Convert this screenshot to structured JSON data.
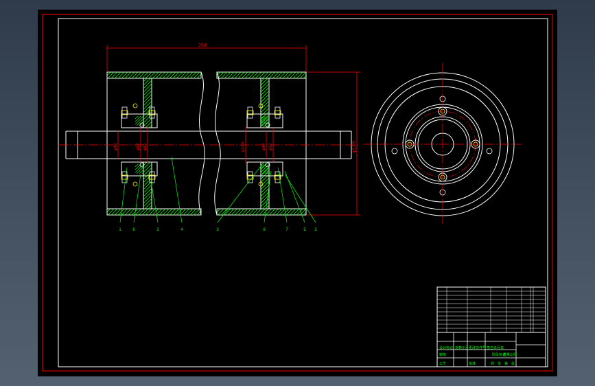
{
  "drawing": {
    "colors": {
      "background": "#000000",
      "frame": "#ff0000",
      "outline": "#ffffff",
      "centerline": "#ff0000",
      "leader": "#00ff00",
      "fastener": "#ffff00",
      "hatch": "#00ff00"
    },
    "dimensions": {
      "overall_length": "350",
      "outer_diameter": "φ120",
      "hub_diameter": "φ130",
      "left_shaft": "φ40",
      "left_bore": "φ52",
      "left_inner": "φ62",
      "right_shaft": "φ40",
      "right_bore": "φ52"
    },
    "part_numbers": [
      "1",
      "6",
      "2",
      "4",
      "3",
      "8",
      "7",
      "5",
      "2"
    ],
    "title_block": {
      "row1": [
        "设计",
        "标记",
        "处数",
        "分区",
        "更改文件号",
        "签名",
        "年月日"
      ],
      "row2": [
        "审核",
        "",
        "工艺",
        "",
        "批准",
        ""
      ],
      "stage_labels": [
        "阶段标记",
        "重量",
        "比例"
      ],
      "sheet_labels": [
        "共",
        "张",
        "第",
        "张"
      ],
      "drawing_name": "",
      "company": ""
    }
  }
}
